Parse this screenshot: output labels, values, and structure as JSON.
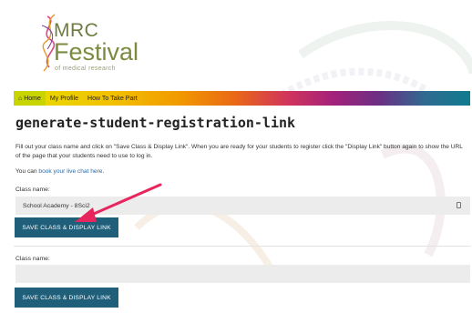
{
  "logo": {
    "line1": "MRC",
    "line2": "Festival",
    "line3": "of medical research"
  },
  "nav": {
    "items": [
      {
        "label": "Home",
        "icon": "home-icon"
      },
      {
        "label": "My Profile"
      },
      {
        "label": "How To Take Part"
      }
    ]
  },
  "page": {
    "title": "generate-student-registration-link",
    "intro": "Fill out your class name and click on \"Save Class & Display Link\". When you are ready for your students to register click the \"Display Link\" button again to show the URL of the page that your students need to use to log in.",
    "chat_prefix": "You can ",
    "chat_link": "book your live chat here",
    "chat_suffix": "."
  },
  "forms": [
    {
      "label": "Class name:",
      "value": "School Academy - 8Sci2",
      "button": "SAVE CLASS & DISPLAY LINK"
    },
    {
      "label": "Class name:",
      "value": "",
      "button": "SAVE CLASS & DISPLAY LINK"
    }
  ],
  "colors": {
    "button": "#1f5f7a",
    "arrow": "#e8265e",
    "nav_home": "#c8d400"
  }
}
